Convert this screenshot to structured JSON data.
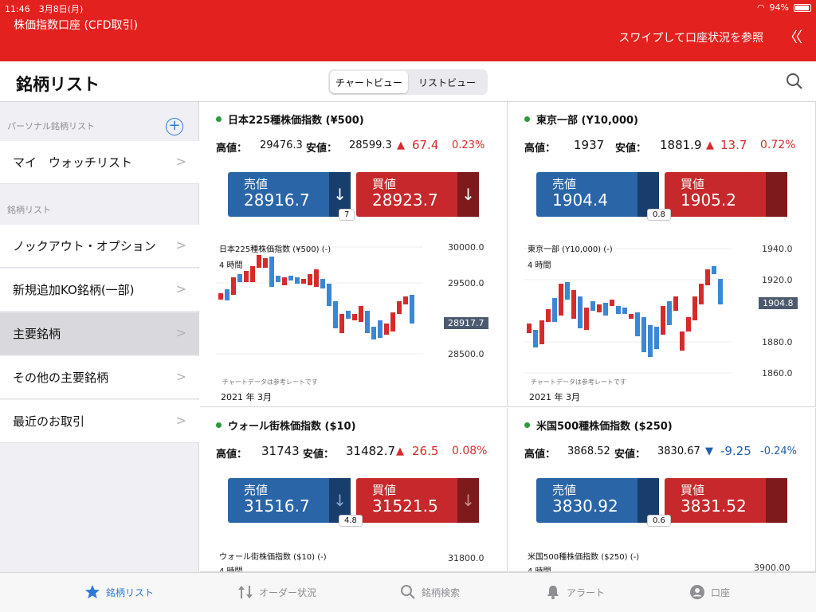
{
  "status": {
    "time": "11:46",
    "date": "3月8日(月)",
    "battery": "94%"
  },
  "header": {
    "account": "株価指数口座 (CFD取引)",
    "swipe": "スワイプして口座状況を参照",
    "collapse": "〈〈"
  },
  "titlebar": {
    "title": "銘柄リスト",
    "views": [
      "チャートビュー",
      "リストビュー"
    ]
  },
  "sidebar": {
    "personal_label": "パーソナル銘柄リスト",
    "watchlist": "マイ　ウォッチリスト",
    "list_label": "銘柄リスト",
    "items": [
      "ノックアウト・オプション",
      "新規追加KO銘柄(一部)",
      "主要銘柄",
      "その他の主要銘柄",
      "最近のお取引"
    ]
  },
  "labels": {
    "high": "高値：",
    "low": "安値：",
    "sell": "売値",
    "buy": "買値",
    "tf": "4 時間",
    "note": "チャートデータは参考レートです",
    "date": "2021 年 3月"
  },
  "cards": [
    {
      "name": "日本225種株価指数 (¥500)",
      "high": "29476.3",
      "low": "28599.3",
      "dir": "▲",
      "change": "67.4",
      "pct": "0.23%",
      "sell": "28916.7",
      "buy": "28923.7",
      "spread": "7",
      "chart_name": "日本225種株価指数 (¥500) (-)",
      "ticks": [
        "30000.0",
        "29500.0",
        "28500.0"
      ],
      "current": "28917.7"
    },
    {
      "name": "東京一部 (Y10,000)",
      "high": "1937",
      "low": "1881.9",
      "dir": "▲",
      "change": "13.7",
      "pct": "0.72%",
      "sell": "1904.4",
      "buy": "1905.2",
      "spread": "0.8",
      "chart_name": "東京一部 (Y10,000) (-)",
      "ticks": [
        "1940.0",
        "1920.0",
        "1880.0",
        "1860.0"
      ],
      "current": "1904.8"
    },
    {
      "name": "ウォール街株価指数 ($10)",
      "high": "31743",
      "low": "31482.7",
      "dir": "▲",
      "change": "26.5",
      "pct": "0.08%",
      "sell": "31516.7",
      "buy": "31521.5",
      "spread": "4.8",
      "chart_name": "ウォール街株価指数 ($10) (-)",
      "ticks": [
        "31800.0"
      ],
      "current": ""
    },
    {
      "name": "米国500種株価指数 ($250)",
      "high": "3868.52",
      "low": "3830.67",
      "dir": "▼",
      "change": "-9.25",
      "pct": "-0.24%",
      "sell": "3830.92",
      "buy": "3831.52",
      "spread": "0.6",
      "chart_name": "米国500種株価指数 ($250) (-)",
      "ticks": [
        "3900.00"
      ],
      "current": ""
    }
  ],
  "tabs": [
    {
      "label": "銘柄リスト",
      "icon": "star-icon"
    },
    {
      "label": "オーダー状況",
      "icon": "arrows-icon"
    },
    {
      "label": "銘柄検索",
      "icon": "search-icon"
    },
    {
      "label": "アラート",
      "icon": "bell-icon"
    },
    {
      "label": "口座",
      "icon": "person-icon"
    }
  ],
  "colors": {
    "red": "#e3211f",
    "sell": "#2a65a8",
    "buy": "#c6282b",
    "up": "#d52b2b",
    "down": "#1f5fae"
  }
}
